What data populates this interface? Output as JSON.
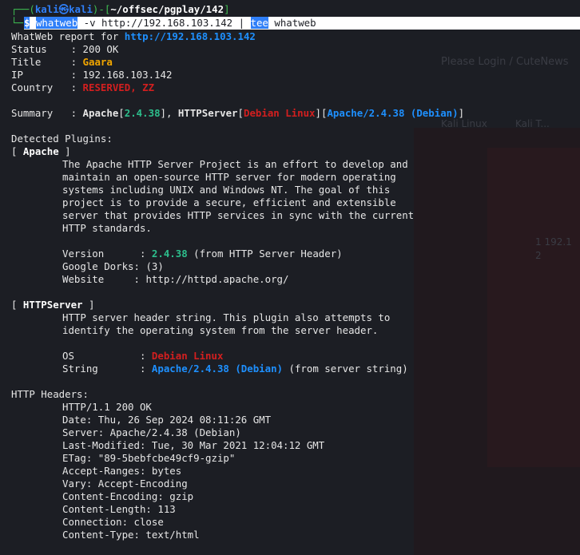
{
  "prompt": {
    "corner": "┌──(",
    "user": "kali㉿kali",
    "sep": ")-[",
    "path": "~/offsec/pgplay/142",
    "end": "]",
    "corner2": "└─",
    "dollar": "$",
    "cmd_whatweb": "whatweb",
    "cmd_flag": " -v ",
    "cmd_url": "http://192.168.103.142",
    "cmd_pipe": " | ",
    "cmd_tee": "tee",
    "cmd_file": " whatweb"
  },
  "report": {
    "header_label": "WhatWeb report for ",
    "header_url": "http://192.168.103.142",
    "status_label": "Status    : ",
    "status_value": "200 OK",
    "title_label": "Title     : ",
    "title_value": "Gaara",
    "ip_label": "IP        : ",
    "ip_value": "192.168.103.142",
    "country_label": "Country   : ",
    "country_value": "RESERVED, ZZ",
    "summary_label": "Summary   : ",
    "summary_apache": "Apache",
    "summary_apache_ver": "2.4.38",
    "summary_httpserver": "HTTPServer",
    "summary_debian": "Debian Linux",
    "summary_apache_debian": "Apache/2.4.38 (Debian)"
  },
  "plugins": {
    "heading": "Detected Plugins:",
    "apache": {
      "name": "Apache",
      "desc": [
        "The Apache HTTP Server Project is an effort to develop and",
        "maintain an open-source HTTP server for modern operating",
        "systems including UNIX and Windows NT. The goal of this",
        "project is to provide a secure, efficient and extensible",
        "server that provides HTTP services in sync with the current",
        "HTTP standards."
      ],
      "version_label": "Version      : ",
      "version_value": "2.4.38",
      "version_note": " (from HTTP Server Header)",
      "dorks_label": "Google Dorks: ",
      "dorks_value": "(3)",
      "website_label": "Website     : ",
      "website_value": "http://httpd.apache.org/"
    },
    "httpserver": {
      "name": "HTTPServer",
      "desc": [
        "HTTP server header string. This plugin also attempts to",
        "identify the operating system from the server header."
      ],
      "os_label": "OS           : ",
      "os_value": "Debian Linux",
      "string_label": "String       : ",
      "string_value": "Apache/2.4.38 (Debian)",
      "string_note": " (from server string)"
    }
  },
  "headers": {
    "heading": "HTTP Headers:",
    "lines": [
      "HTTP/1.1 200 OK",
      "Date: Thu, 26 Sep 2024 08:11:26 GMT",
      "Server: Apache/2.4.38 (Debian)",
      "Last-Modified: Tue, 30 Mar 2021 12:04:12 GMT",
      "ETag: \"89-5bebfcbe49cf9-gzip\"",
      "Accept-Ranges: bytes",
      "Vary: Accept-Encoding",
      "Content-Encoding: gzip",
      "Content-Length: 113",
      "Connection: close",
      "Content-Type: text/html"
    ]
  },
  "background": {
    "login_text": "Please Login / CuteNews",
    "tab_text": "Kali Linux",
    "tab2_text": "Kali T...",
    "num1": "1 192.1",
    "num2": "2"
  }
}
